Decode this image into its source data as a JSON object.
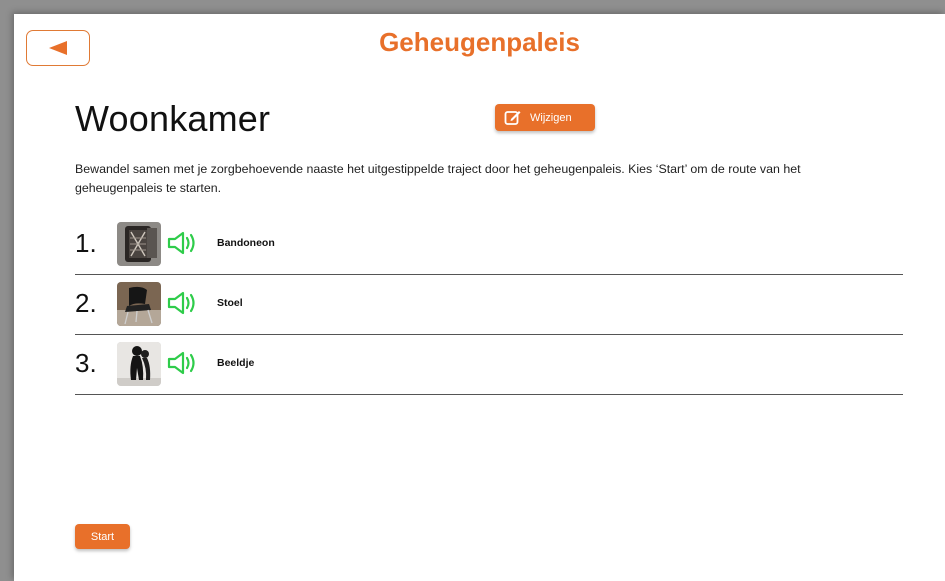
{
  "header": {
    "title": "Geheugenpaleis",
    "back_icon": "back-arrow-icon"
  },
  "room": {
    "title": "Woonkamer",
    "edit_label": "Wijzigen",
    "edit_icon": "edit-pencil-icon",
    "description": "Bewandel samen met je zorgbehoevende naaste het uitgestippelde traject door het geheugenpaleis. Kies ‘Start’ om de route van het geheugenpaleis te starten."
  },
  "route": {
    "items": [
      {
        "number": "1.",
        "label": "Bandoneon",
        "thumbnail": "bandoneon-photo",
        "audio_icon": "speaker-icon"
      },
      {
        "number": "2.",
        "label": "Stoel",
        "thumbnail": "chair-photo",
        "audio_icon": "speaker-icon"
      },
      {
        "number": "3.",
        "label": "Beeldje",
        "thumbnail": "statue-photo",
        "audio_icon": "speaker-icon"
      }
    ]
  },
  "footer": {
    "start_label": "Start"
  },
  "colors": {
    "accent": "#e8702a",
    "speaker": "#2ecc4a"
  }
}
